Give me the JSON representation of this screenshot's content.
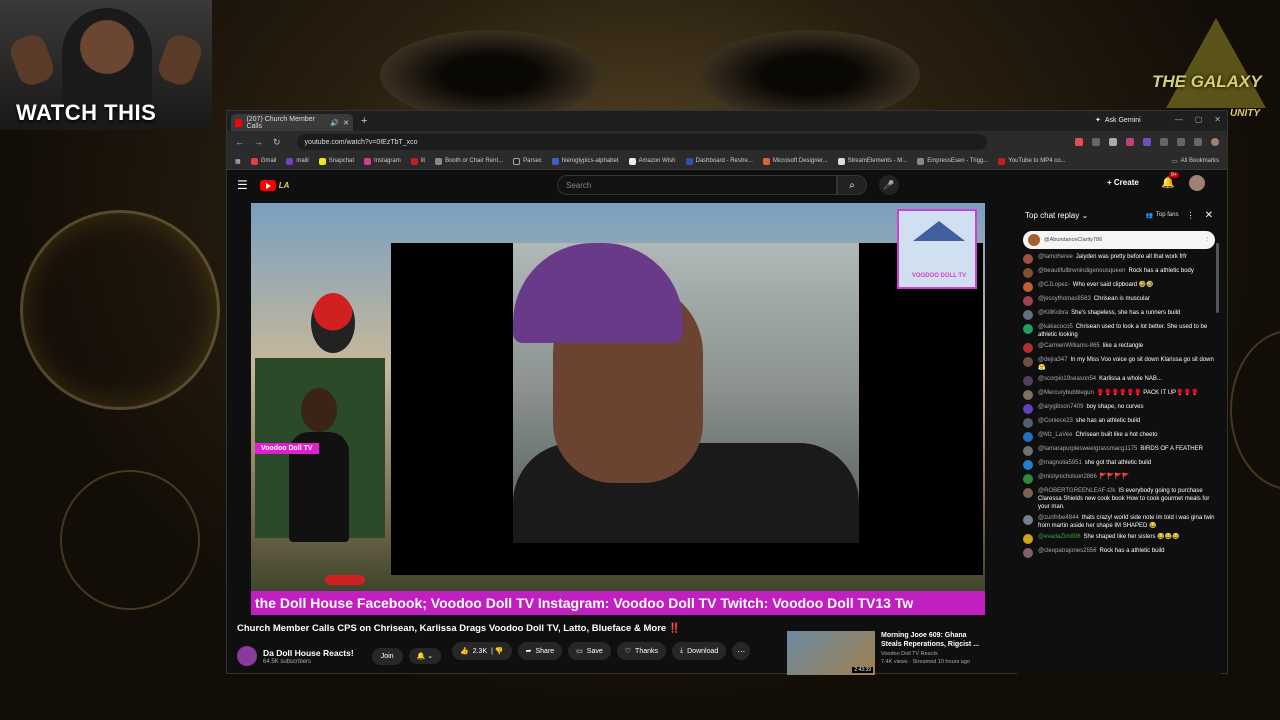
{
  "overlay": {
    "watch_label": "WATCH THIS",
    "galaxy_title": "THE GALAXY",
    "galaxy_sub": "UNITY"
  },
  "browser": {
    "tab_title": "(207) Church Member Calls",
    "url": "youtube.com/watch?v=0IEzTbT_xco",
    "ask_gemini": "Ask Gemini",
    "bookmarks": [
      "Gmail",
      "maill",
      "Snapchat",
      "Instagram",
      "lit",
      "Booth or Chair Rent...",
      "Parsec",
      "hieroglypics-alphabet",
      "Amazon Wish",
      "Dashboard - Restre...",
      "Microsoft Designer...",
      "StreamElements - M...",
      "EmpressEsen - Trigg...",
      "YouTube to MP4 co..."
    ],
    "all_bookmarks": "All Bookmarks"
  },
  "youtube": {
    "search_placeholder": "Search",
    "create_label": "Create",
    "notif_count": "9+",
    "video_ticker": "the Doll House Facebook; Voodoo Doll TV Instagram: Voodoo Doll TV Twitch: Voodoo Doll TV13 Tw",
    "doll_tag": "Voodoo Doll TV",
    "voodoo_logo_text": "VOODOO DOLL TV",
    "title": "Church Member Calls CPS on Chrisean, Karlissa Drags Voodoo Doll TV, Latto, Blueface & More ‼️",
    "channel_name": "Da Doll House Reacts!",
    "channel_subs": "64.5K subscribers",
    "join_label": "Join",
    "like_count": "2.3K",
    "share_label": "Share",
    "save_label": "Save",
    "thanks_label": "Thanks",
    "download_label": "Download",
    "suggest_title": "Morning Jooe 609: Ghana Steals Reperations, Rigcist ...",
    "suggest_channel": "Voodoo Doll TV Reacts",
    "suggest_meta": "7.4K views · Streamed 10 hours ago",
    "suggest_duration": "2:43:39"
  },
  "chat": {
    "header": "Top chat replay",
    "top_fans": "Top fans",
    "pinned_user": "@AbundanceClarity786",
    "messages": [
      {
        "user": "@tamoheree",
        "text": "Jaiyden was pretty before all that work frfr",
        "color": "#a05040"
      },
      {
        "user": "@beautifulbrwnindigenousqueen",
        "text": "Rock has a athletic body",
        "color": "#805030"
      },
      {
        "user": "@CJLopez-",
        "text": "Who ever said clipboard 🤣🤣",
        "color": "#c06030"
      },
      {
        "user": "@jessythomas8583",
        "text": "Chrisean is muscular",
        "color": "#a04050"
      },
      {
        "user": "@KillKobra",
        "text": "She's shapeless, she has a runners build",
        "color": "#607080"
      },
      {
        "user": "@kakacoco5",
        "text": "Chrisean used to look a lot better. She used to be athletic looking",
        "color": "#20a060"
      },
      {
        "user": "@CarmenWilliams-865",
        "text": "like a rectangle",
        "color": "#b03030"
      },
      {
        "user": "@dejra347",
        "text": "In my Miss Voo voice go sit down Klarissa go sit down 😤",
        "color": "#705040"
      },
      {
        "user": "@scorpio19season54",
        "text": "Karlissa a whole NAB...",
        "color": "#504060"
      },
      {
        "user": "@Mercurybubblegun",
        "text": "🥊🥊🥊🥊🥊🥊 PACK IT UP🥊🥊🥊",
        "color": "#807060"
      },
      {
        "user": "@arygibson7409",
        "text": "boy shape, no curves",
        "color": "#6040c0"
      },
      {
        "user": "@Coniece23",
        "text": "she has an athletic build",
        "color": "#506070"
      },
      {
        "user": "@Mz_LaVee",
        "text": "Chrisean built like a hot cheeto",
        "color": "#2070c0"
      },
      {
        "user": "@tamarapurplesweetgrassmacg1175",
        "text": "BIRDS OF A FEATHER",
        "color": "#707070"
      },
      {
        "user": "@magnolia5951",
        "text": "she got that athletic build",
        "color": "#2080d0"
      },
      {
        "user": "@mistynicholson2866",
        "text": "🚩🚩🚩🚩",
        "color": "#2a8a40"
      },
      {
        "user": "@ROBERTGREENLEAF-t2k",
        "text": "IS everybody going to purchase Claressa Shields new cook book How to cook gourmet meals for your man.",
        "color": "#806050"
      },
      {
        "user": "@zurifribe4844",
        "text": "thats crazy! world side note im told i was gina twin from martin aside her shape IM SHAPED 😂",
        "color": "#708090"
      },
      {
        "user": "@evadaZim806",
        "text": "She shaped like her sisters 😂😂😂",
        "color": "#d0a020",
        "green": true
      },
      {
        "user": "@cleopatrajones2556",
        "text": "Rock has a athletic build",
        "color": "#806070"
      }
    ]
  }
}
